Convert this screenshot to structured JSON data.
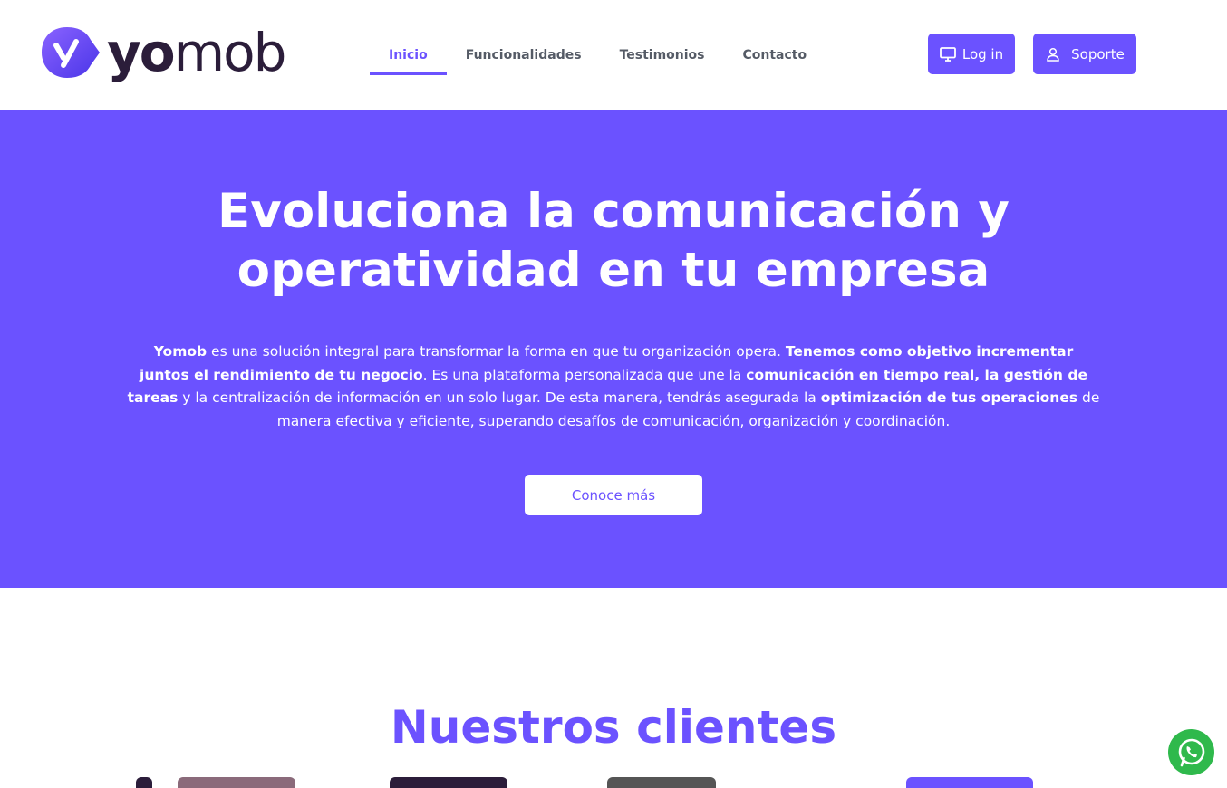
{
  "brand": {
    "name_bold": "yo",
    "name_light": "mob",
    "accent": "#6b52ff"
  },
  "nav": {
    "items": [
      "Inicio",
      "Funcionalidades",
      "Testimonios",
      "Contacto"
    ],
    "active": "Inicio"
  },
  "buttons": {
    "login": "Log in",
    "support": "Soporte"
  },
  "hero": {
    "title_line1": "Evoluciona la comunicación y",
    "title_line2": "operatividad en tu empresa",
    "p_yomob": "Yomob",
    "p_1": " es una solución integral para transformar la forma en que tu organización opera. ",
    "p_bold_1": "Tenemos como objetivo incrementar juntos el rendimiento de tu negocio",
    "p_2": ". Es una plataforma personalizada que une la ",
    "p_bold_2": "comunicación en tiempo real, la gestión de tareas",
    "p_3": " y la centralización de información en un solo lugar. De esta manera, tendrás asegurada la ",
    "p_bold_3": "optimización de tus operaciones",
    "p_4": " de manera efectiva y eficiente, superando desafíos de comunicación, organización y coordinación.",
    "cta": "Conoce más"
  },
  "clients": {
    "title": "Nuestros clientes"
  },
  "icons": {
    "login": "monitor-icon",
    "support": "user-icon",
    "whatsapp": "whatsapp-icon"
  }
}
